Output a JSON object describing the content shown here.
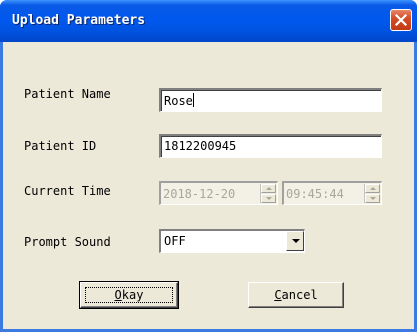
{
  "window": {
    "title": "Upload Parameters",
    "close_icon": "close-icon",
    "accent_color": "#0054e3",
    "close_color": "#d44d27"
  },
  "form": {
    "patient_name": {
      "label": "Patient Name",
      "value": "Rose"
    },
    "patient_id": {
      "label": "Patient ID",
      "value": "1812200945"
    },
    "current_time": {
      "label": "Current Time",
      "date_value": "2018-12-20",
      "time_value": "09:45:44",
      "disabled": true
    },
    "prompt_sound": {
      "label": "Prompt Sound",
      "selected": "OFF"
    }
  },
  "buttons": {
    "okay": {
      "accel": "O",
      "rest": "kay"
    },
    "cancel": {
      "accel": "C",
      "rest": "ancel"
    }
  }
}
